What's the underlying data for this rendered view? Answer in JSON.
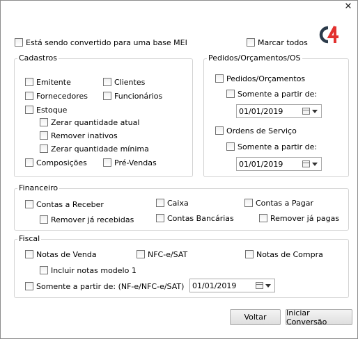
{
  "window": {
    "close_glyph": "✕"
  },
  "top": {
    "mei_label": "Está sendo convertido para uma base MEI",
    "select_all_label": "Marcar todos"
  },
  "colors": {
    "logo_dark": "#2b3a4a",
    "logo_red": "#e2312f"
  },
  "cadastros": {
    "title": "Cadastros",
    "emitente": "Emitente",
    "clientes": "Clientes",
    "fornecedores": "Fornecedores",
    "funcionarios": "Funcionários",
    "estoque": "Estoque",
    "zerar_qtd_atual": "Zerar quantidade atual",
    "remover_inativos": "Remover inativos",
    "zerar_qtd_minima": "Zerar quantidade mínima",
    "composicoes": "Composições",
    "pre_vendas": "Pré-Vendas"
  },
  "pedidos": {
    "title": "Pedidos/Orçamentos/OS",
    "pedidos_orcamentos": "Pedidos/Orçamentos",
    "somente_label_1": "Somente a partir de:",
    "date_1": "01/01/2019",
    "ordens_servico": "Ordens de Serviço",
    "somente_label_2": "Somente a partir de:",
    "date_2": "01/01/2019"
  },
  "financeiro": {
    "title": "Financeiro",
    "contas_receber": "Contas a Receber",
    "caixa": "Caixa",
    "contas_pagar": "Contas a Pagar",
    "remover_recebidas": "Remover já recebidas",
    "contas_bancarias": "Contas Bancárias",
    "remover_pagas": "Remover já pagas"
  },
  "fiscal": {
    "title": "Fiscal",
    "notas_venda": "Notas de Venda",
    "nfce_sat": "NFC-e/SAT",
    "notas_compra": "Notas de Compra",
    "incluir_modelo1": "Incluir notas modelo 1",
    "somente_label": "Somente a partir de: (NF-e/NFC-e/SAT)",
    "date": "01/01/2019"
  },
  "buttons": {
    "voltar": "Voltar",
    "iniciar": "Iniciar Conversão"
  }
}
